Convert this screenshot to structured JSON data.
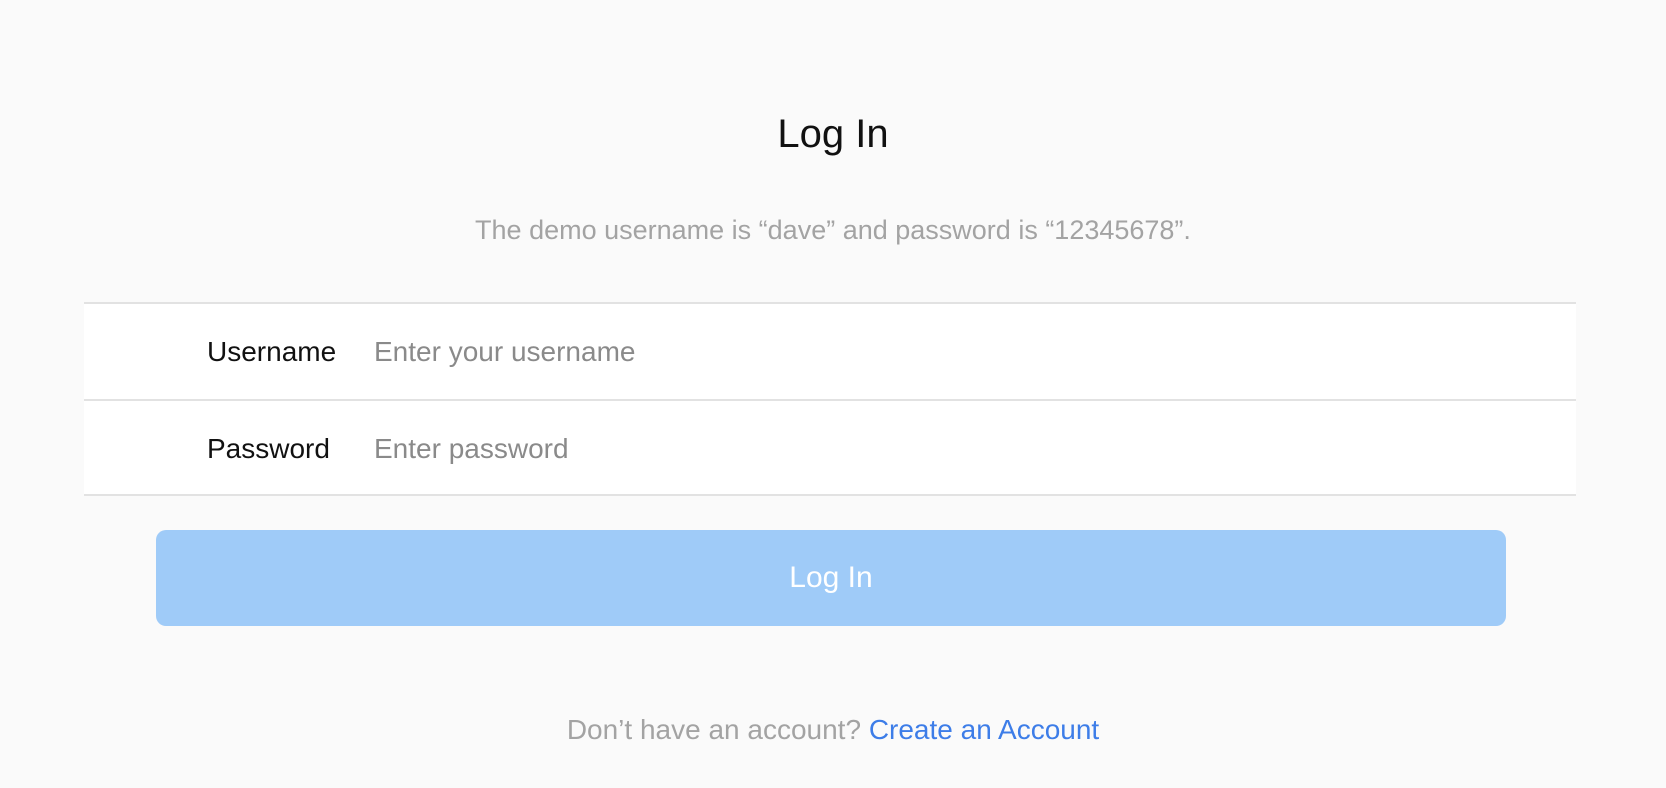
{
  "header": {
    "title": "Log In",
    "hint": "The demo username is “dave” and password is “12345678”."
  },
  "form": {
    "username": {
      "label": "Username",
      "placeholder": "Enter your username",
      "value": ""
    },
    "password": {
      "label": "Password",
      "placeholder": "Enter password",
      "value": ""
    },
    "submit_label": "Log In"
  },
  "footer": {
    "prompt": "Don’t have an account?",
    "link_label": "Create an Account"
  },
  "colors": {
    "background": "#fafafa",
    "button": "#9fcbf8",
    "link": "#3d7de8",
    "muted_text": "#a3a3a3"
  }
}
